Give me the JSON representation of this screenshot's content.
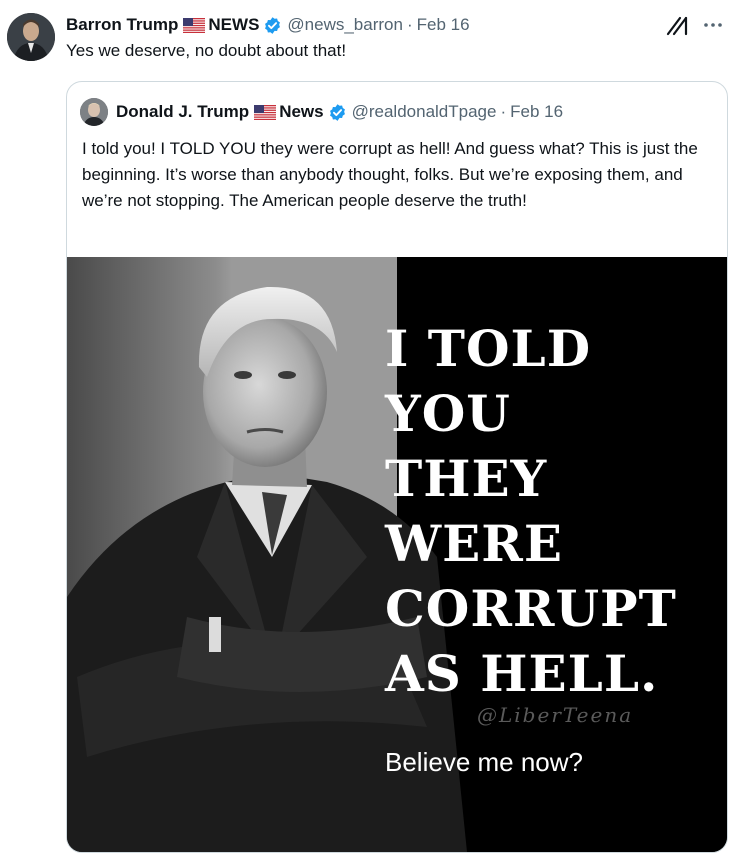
{
  "tweet": {
    "author_name": "Barron Trump",
    "author_suffix": "NEWS",
    "handle": "@news_barron",
    "separator": "·",
    "date": "Feb 16",
    "text": "Yes we deserve, no doubt about that!",
    "icons": {
      "grok": "grok-icon",
      "more": "more-icon",
      "flag": "us-flag-icon",
      "badge": "verified-badge-icon"
    }
  },
  "quote": {
    "author_name": "Donald J. Trump",
    "author_suffix": "News",
    "handle": "@realdonaldTpage",
    "separator": "·",
    "date": "Feb 16",
    "text": "I told you! I TOLD YOU they were corrupt as hell! And guess what? This is just the beginning. It’s worse than anybody thought, folks. But we’re exposing them, and we’re not stopping. The American people deserve the truth!",
    "image": {
      "lines": [
        "I TOLD",
        "YOU",
        "THEY",
        "WERE",
        "CORRUPT",
        "AS HELL."
      ],
      "watermark": "@LiberTeena",
      "caption": "Believe me now?"
    }
  },
  "colors": {
    "text": "#0f1419",
    "secondary": "#536471",
    "verified": "#1d9bf0",
    "border": "#cfd9de"
  }
}
